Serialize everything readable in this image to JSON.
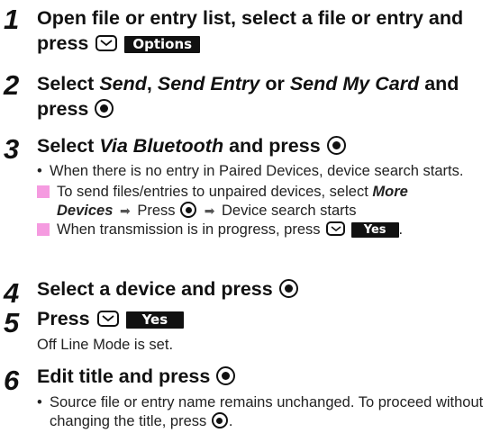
{
  "steps": [
    {
      "number": "1",
      "heading_a": "Open file or entry list, select a file or entry and",
      "heading_b": "press",
      "key": "Options"
    },
    {
      "number": "2",
      "heading_pre": "Select",
      "opt1": "Send",
      "opt2": "Send Entry",
      "or": "or",
      "opt3": "Send My Card",
      "and": "and",
      "heading_b": "press"
    },
    {
      "number": "3",
      "heading_pre": "Select",
      "opt": "Via Bluetooth",
      "heading_post": "and press",
      "bullet": "When there is no entry in Paired Devices, device search starts.",
      "note1_a": "To send files/entries to unpaired devices, select",
      "note1_more": "More",
      "note1_devices": "Devices",
      "note1_press": "Press",
      "note1_result": "Device search starts",
      "note2_a": "When transmission is in progress, press",
      "note2_key": "Yes"
    },
    {
      "number": "4",
      "heading": "Select a device and press"
    },
    {
      "number": "5",
      "heading": "Press",
      "key": "Yes",
      "body": "Off Line Mode is set."
    },
    {
      "number": "6",
      "heading": "Edit title and press",
      "bullet": "Source file or entry name remains unchanged. To proceed without changing the title, press"
    }
  ],
  "icons": {
    "center_key": "center-select-icon",
    "soft_key": "soft-key-icon",
    "arrow": "arrow-right-icon"
  },
  "colors": {
    "note_marker": "#f59be0",
    "key_bg": "#111111"
  }
}
